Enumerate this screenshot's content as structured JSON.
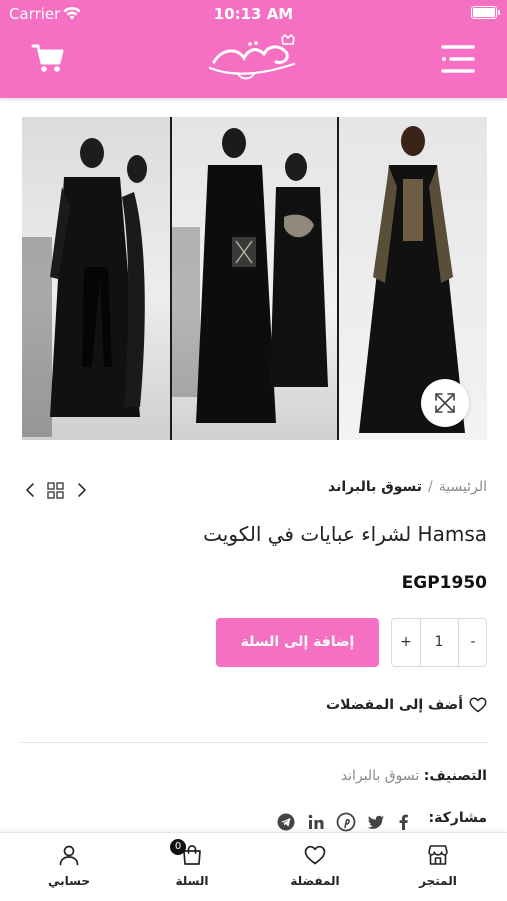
{
  "status_bar": {
    "carrier": "Carrier",
    "time": "10:13 AM",
    "battery_level": 0.9
  },
  "header": {
    "cart_icon": "cart-icon",
    "logo_icon": "naeomi-mall-logo",
    "menu_icon": "hamburger-menu-icon"
  },
  "gallery": {
    "expand_icon": "expand-icon"
  },
  "breadcrumb": {
    "home": "الرئيسية",
    "separator": "/",
    "current": "تسوق بالبراند"
  },
  "product": {
    "title": "Hamsa لشراء عبايات في الكويت",
    "price": "EGP1950",
    "quantity": "1",
    "qty_minus": "-",
    "qty_plus": "+",
    "add_to_cart": "إضافة إلى السلة",
    "wishlist": "أضف إلى المفضلات"
  },
  "meta": {
    "category_label": "التصنيف:",
    "category_value": "تسوق بالبراند",
    "share_label": "مشاركة:",
    "share_icons": [
      "facebook-icon",
      "twitter-icon",
      "pinterest-icon",
      "linkedin-icon",
      "telegram-icon"
    ]
  },
  "tabbar": {
    "items": [
      {
        "label": "المتجر",
        "icon": "store-icon"
      },
      {
        "label": "المفضلة",
        "icon": "heart-icon"
      },
      {
        "label": "السلة",
        "icon": "shopping-bag-icon",
        "badge": "0"
      },
      {
        "label": "حسابي",
        "icon": "user-icon"
      }
    ]
  },
  "colors": {
    "brand": "#f56fc3",
    "text": "#222222",
    "muted": "#8a8a8a"
  }
}
